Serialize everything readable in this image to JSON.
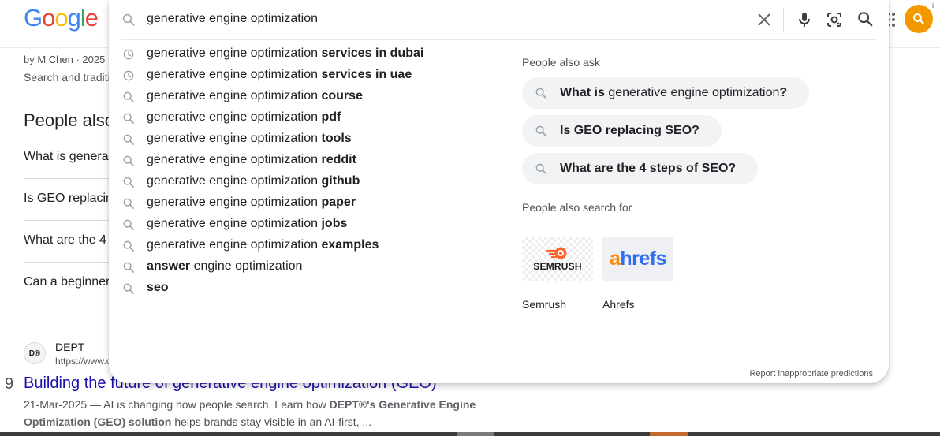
{
  "logo": [
    "G",
    "o",
    "o",
    "g",
    "l",
    "e"
  ],
  "background": {
    "byline": "by M Chen · 2025",
    "snippet": "Search and traditi",
    "paa_heading": "People also",
    "paa_questions": [
      "What is generat",
      "Is GEO replacin",
      "What are the 4",
      "Can a beginner"
    ],
    "favicon_text": "D®",
    "site_name": "DEPT",
    "site_url": "https://www.c",
    "result_number": "9",
    "result_title": "Building the future of generative engine optimization (GEO)",
    "snippet_line1_plain": "21-Mar-2025 — AI is changing how people search. Learn how ",
    "snippet_line1_bold": "DEPT®'s Generative Engine",
    "snippet_line2_bold": "Optimization (GEO) solution",
    "snippet_line2_plain": " helps brands stay visible in an AI-first, ..."
  },
  "search": {
    "query": "generative engine optimization"
  },
  "suggestions": [
    {
      "icon": "history-icon",
      "prefix": "generative engine optimization ",
      "bold": "services in dubai",
      "suffix": ""
    },
    {
      "icon": "history-icon",
      "prefix": "generative engine optimization ",
      "bold": "services in uae",
      "suffix": ""
    },
    {
      "icon": "search-icon",
      "prefix": "generative engine optimization ",
      "bold": "course",
      "suffix": ""
    },
    {
      "icon": "search-icon",
      "prefix": "generative engine optimization ",
      "bold": "pdf",
      "suffix": ""
    },
    {
      "icon": "search-icon",
      "prefix": "generative engine optimization ",
      "bold": "tools",
      "suffix": ""
    },
    {
      "icon": "search-icon",
      "prefix": "generative engine optimization ",
      "bold": "reddit",
      "suffix": ""
    },
    {
      "icon": "search-icon",
      "prefix": "generative engine optimization ",
      "bold": "github",
      "suffix": ""
    },
    {
      "icon": "search-icon",
      "prefix": "generative engine optimization ",
      "bold": "paper",
      "suffix": ""
    },
    {
      "icon": "search-icon",
      "prefix": "generative engine optimization ",
      "bold": "jobs",
      "suffix": ""
    },
    {
      "icon": "search-icon",
      "prefix": "generative engine optimization ",
      "bold": "examples",
      "suffix": ""
    },
    {
      "icon": "search-icon",
      "prefix": "",
      "bold": "answer",
      "suffix": " engine optimization"
    },
    {
      "icon": "search-icon",
      "prefix": "",
      "bold": "seo",
      "suffix": ""
    }
  ],
  "people_also_ask": {
    "title": "People also ask",
    "chips": [
      {
        "bold": "What is",
        "plain": " generative engine optimization",
        "bold2": "?"
      },
      {
        "bold": "Is GEO replacing SEO?",
        "plain": "",
        "bold2": ""
      },
      {
        "bold": "What are the 4 steps of SEO?",
        "plain": "",
        "bold2": ""
      }
    ]
  },
  "people_also_search_for": {
    "title": "People also search for",
    "entities": [
      {
        "label": "Semrush",
        "logo_text": "SEMRUSH"
      },
      {
        "label": "Ahrefs",
        "logo_a": "a",
        "logo_rest": "hrefs"
      }
    ]
  },
  "report_link": "Report inappropriate predictions",
  "colors": {
    "accent": "#1a0dab",
    "avatar": "#f29900",
    "chip": "#f1f3f4"
  }
}
